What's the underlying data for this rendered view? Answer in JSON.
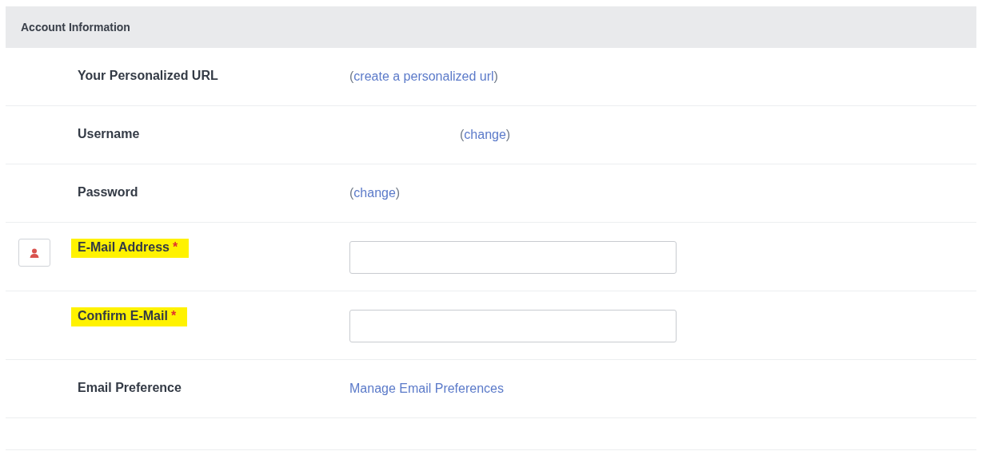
{
  "section": {
    "title": "Account Information"
  },
  "rows": [
    {
      "kind": "link",
      "label": "Your Personalized URL",
      "before": "(",
      "link": "create a personalized url",
      "after": ")"
    },
    {
      "kind": "offset-link",
      "label": "Username",
      "before": "(",
      "link": "change",
      "after": ")"
    },
    {
      "kind": "link",
      "label": "Password",
      "before": "(",
      "link": "change",
      "after": ")"
    },
    {
      "kind": "input",
      "label": "E-Mail Address",
      "required_mark": "*",
      "highlighted": true,
      "has_icon_button": true
    },
    {
      "kind": "input",
      "label": "Confirm E-Mail",
      "required_mark": "*",
      "highlighted": true,
      "has_icon_button": false
    },
    {
      "kind": "plainlink",
      "label": "Email Preference",
      "link": "Manage Email Preferences"
    }
  ]
}
